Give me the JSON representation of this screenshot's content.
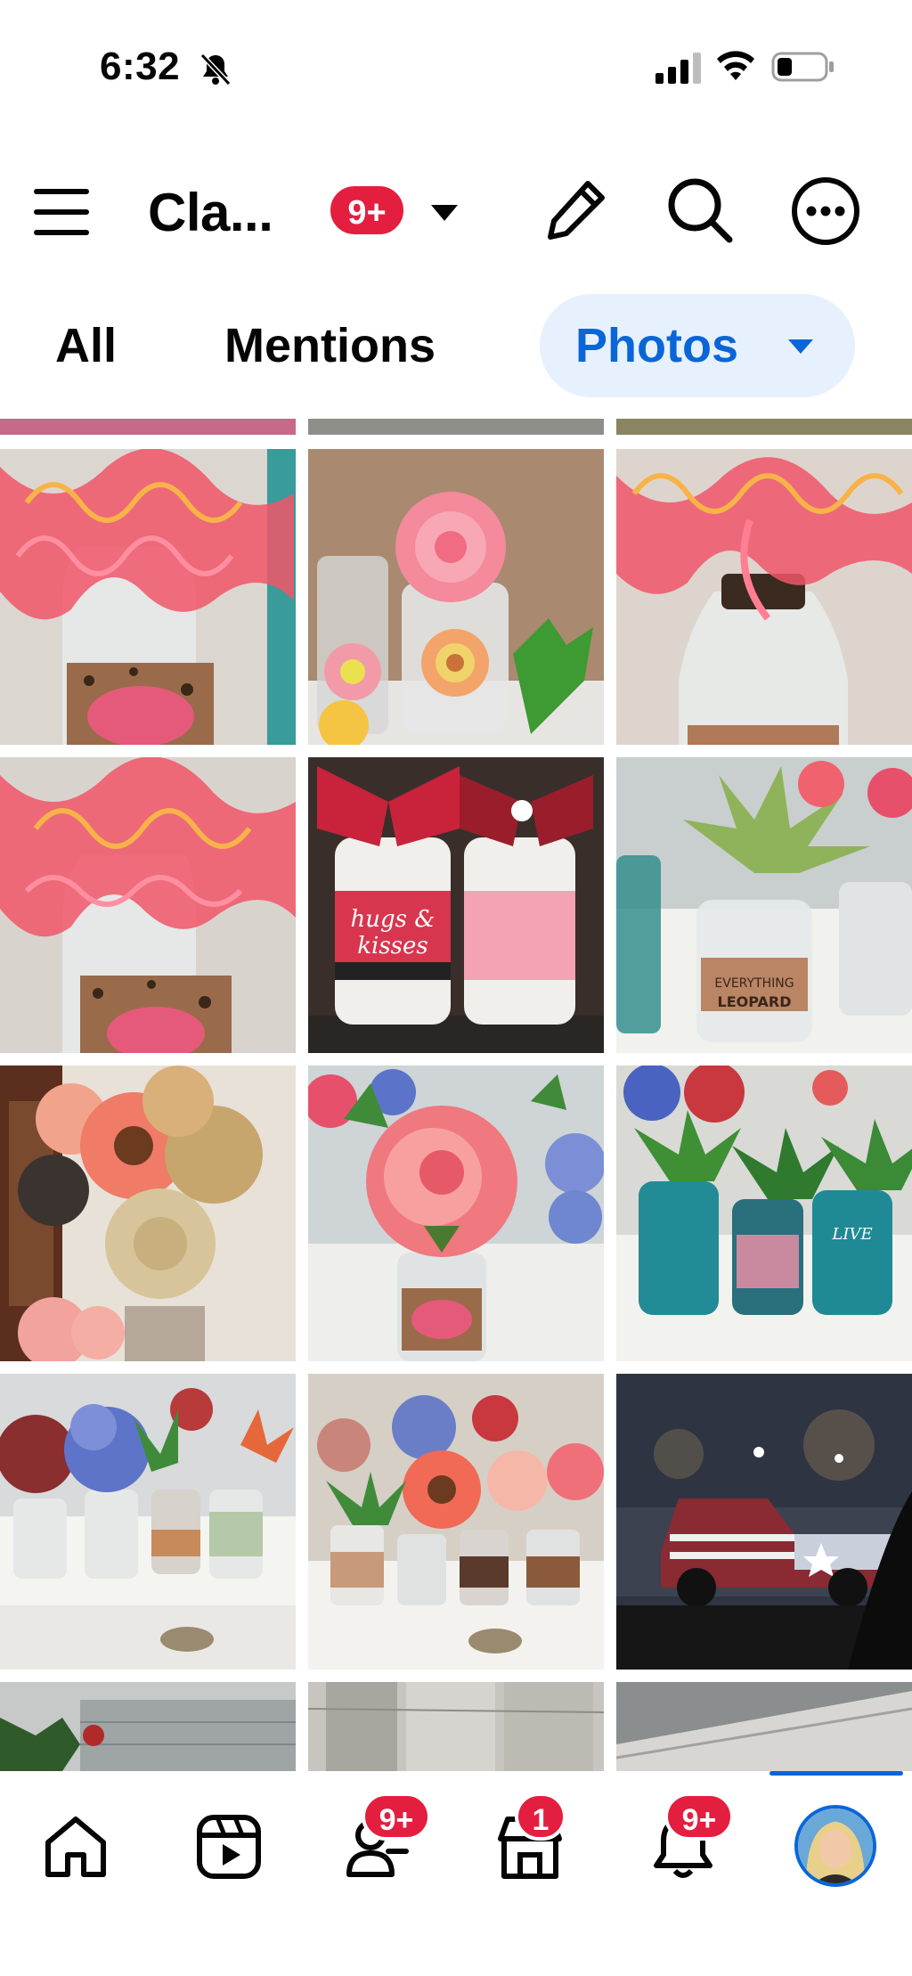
{
  "status_bar": {
    "time": "6:32",
    "icons": [
      "bell-off-icon",
      "signal-icon",
      "wifi-icon",
      "battery-icon"
    ]
  },
  "header": {
    "title": "Cla...",
    "badge": "9+",
    "icons": [
      "menu-icon",
      "caret-down-icon",
      "pencil-icon",
      "search-icon",
      "more-icon"
    ]
  },
  "tabs": {
    "all": "All",
    "mentions": "Mentions",
    "photos": "Photos"
  },
  "photos": {
    "items": [
      "photo-bottle-curly-ribbon-1",
      "photo-bottle-pink-bow",
      "photo-bottle-curly-ribbon-2",
      "photo-bottle-curly-ribbon-3",
      "photo-hugs-kisses-bottles",
      "photo-succulent-everything-leopard",
      "photo-burlap-flowers",
      "photo-pink-peony-hello",
      "photo-teal-bottles-succulents",
      "photo-bottles-hydrangeas",
      "photo-bottles-flowers-counter",
      "photo-flag-truck-night",
      "photo-greenery-garage",
      "photo-wood-table",
      "photo-wood-planks"
    ],
    "bottle_labels": {
      "hugs": "hugs &",
      "kisses": "kisses",
      "everything": "EVERYTHING",
      "leopard": "LEOPARD",
      "live": "LIVE"
    }
  },
  "bottom_nav": {
    "items": [
      "home-icon",
      "reels-icon",
      "friends-icon",
      "marketplace-icon",
      "notifications-icon",
      "profile-avatar"
    ],
    "friends_badge": "9+",
    "marketplace_badge": "1",
    "notifications_badge": "9+"
  },
  "colors": {
    "accent": "#0a66d8",
    "badge": "#e41e3f",
    "active_tab_bg": "#e7f1fd"
  }
}
